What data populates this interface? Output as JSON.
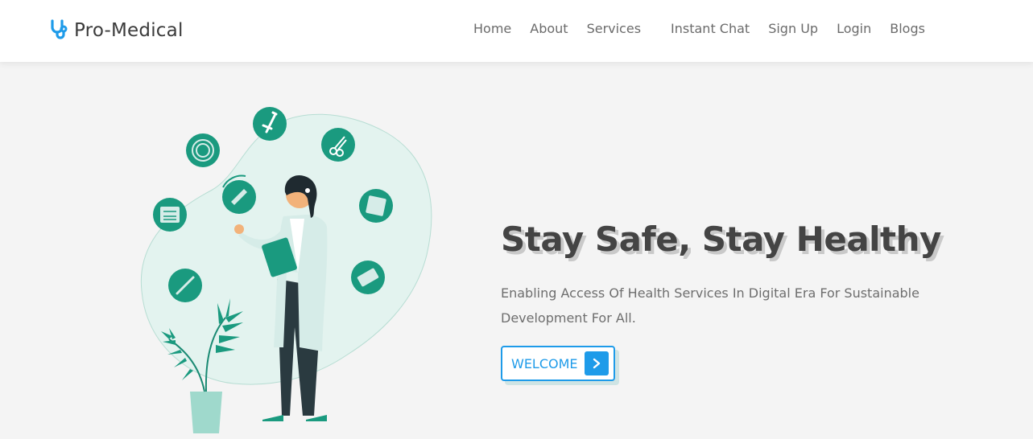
{
  "brand": {
    "name": "Pro-Medical",
    "icon": "stethoscope-icon"
  },
  "nav": {
    "items": [
      {
        "label": "Home"
      },
      {
        "label": "About"
      },
      {
        "label": "Services"
      },
      {
        "label": "Instant Chat"
      },
      {
        "label": "Sign Up"
      },
      {
        "label": "Login"
      },
      {
        "label": "Blogs"
      }
    ]
  },
  "hero": {
    "title": "Stay Safe, Stay Healthy",
    "subtitle": "Enabling Access Of Health Services In Digital Era For Sustainable Development For All.",
    "button_label": "WELCOME",
    "button_icon": "chevron-right-icon"
  },
  "colors": {
    "accent": "#1e9be9",
    "teal": "#1a9a7f",
    "blob": "#e3f3ef",
    "background": "#f4f4f4"
  }
}
